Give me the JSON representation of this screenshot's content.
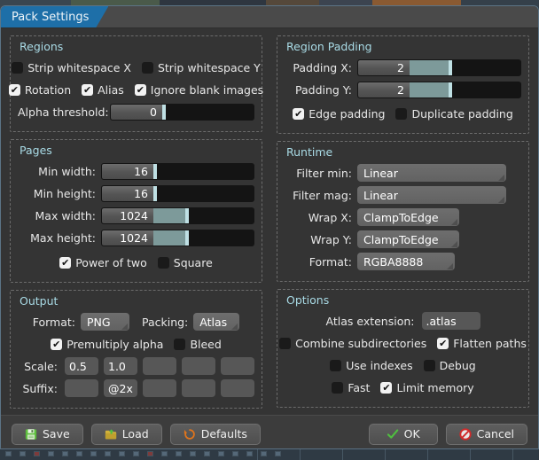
{
  "window": {
    "tab_label": "Pack Settings"
  },
  "regions": {
    "title": "Regions",
    "strip_ws_x": {
      "label": "Strip whitespace X",
      "checked": false
    },
    "strip_ws_y": {
      "label": "Strip whitespace Y",
      "checked": false
    },
    "rotation": {
      "label": "Rotation",
      "checked": true
    },
    "alias": {
      "label": "Alias",
      "checked": true
    },
    "ignore_blank": {
      "label": "Ignore blank images",
      "checked": true
    },
    "alpha_threshold": {
      "label": "Alpha threshold:",
      "value": "0",
      "fill_percent": 0
    }
  },
  "region_padding": {
    "title": "Region Padding",
    "padding_x": {
      "label": "Padding X:",
      "value": "2",
      "fill_percent": 25
    },
    "padding_y": {
      "label": "Padding Y:",
      "value": "2",
      "fill_percent": 25
    },
    "edge_padding": {
      "label": "Edge padding",
      "checked": true
    },
    "duplicate_padding": {
      "label": "Duplicate padding",
      "checked": false
    }
  },
  "pages": {
    "title": "Pages",
    "min_width": {
      "label": "Min width:",
      "value": "16",
      "fill_percent": 0
    },
    "min_height": {
      "label": "Min height:",
      "value": "16",
      "fill_percent": 0
    },
    "max_width": {
      "label": "Max width:",
      "value": "1024",
      "fill_percent": 30
    },
    "max_height": {
      "label": "Max height:",
      "value": "1024",
      "fill_percent": 30
    },
    "power_of_two": {
      "label": "Power of two",
      "checked": true
    },
    "square": {
      "label": "Square",
      "checked": false
    }
  },
  "runtime": {
    "title": "Runtime",
    "filter_min": {
      "label": "Filter min:",
      "value": "Linear"
    },
    "filter_mag": {
      "label": "Filter mag:",
      "value": "Linear"
    },
    "wrap_x": {
      "label": "Wrap X:",
      "value": "ClampToEdge"
    },
    "wrap_y": {
      "label": "Wrap Y:",
      "value": "ClampToEdge"
    },
    "format": {
      "label": "Format:",
      "value": "RGBA8888"
    }
  },
  "output": {
    "title": "Output",
    "format": {
      "label": "Format:",
      "value": "PNG"
    },
    "packing": {
      "label": "Packing:",
      "value": "Atlas"
    },
    "premultiply_alpha": {
      "label": "Premultiply alpha",
      "checked": true
    },
    "bleed": {
      "label": "Bleed",
      "checked": false
    },
    "scale": {
      "label": "Scale:",
      "values": [
        "0.5",
        "1.0",
        "",
        "",
        ""
      ]
    },
    "suffix": {
      "label": "Suffix:",
      "values": [
        "",
        "@2x",
        "",
        "",
        ""
      ]
    }
  },
  "options": {
    "title": "Options",
    "atlas_extension": {
      "label": "Atlas extension:",
      "value": ".atlas"
    },
    "combine_subdirectories": {
      "label": "Combine subdirectories",
      "checked": false
    },
    "flatten_paths": {
      "label": "Flatten paths",
      "checked": true
    },
    "use_indexes": {
      "label": "Use indexes",
      "checked": false
    },
    "debug": {
      "label": "Debug",
      "checked": false
    },
    "fast": {
      "label": "Fast",
      "checked": false
    },
    "limit_memory": {
      "label": "Limit memory",
      "checked": true
    }
  },
  "footer": {
    "save": "Save",
    "load": "Load",
    "defaults": "Defaults",
    "ok": "OK",
    "cancel": "Cancel"
  },
  "colors": {
    "tab_active": "#1e6fa8",
    "group_title": "#a9dbe6",
    "slider_fill": "#7d9a9a",
    "slider_knob": "#bfe0e4",
    "save_icon": "#5fbf3f",
    "load_icon": "#d2b23c",
    "defaults_icon": "#e0741c",
    "ok_icon": "#4fbf3f",
    "cancel_icon": "#d02a2a"
  }
}
